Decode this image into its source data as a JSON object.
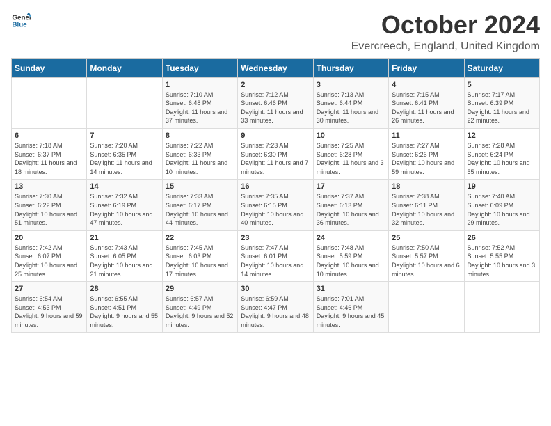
{
  "logo": {
    "line1": "General",
    "line2": "Blue"
  },
  "title": "October 2024",
  "location": "Evercreech, England, United Kingdom",
  "days_header": [
    "Sunday",
    "Monday",
    "Tuesday",
    "Wednesday",
    "Thursday",
    "Friday",
    "Saturday"
  ],
  "weeks": [
    [
      {
        "day": "",
        "sunrise": "",
        "sunset": "",
        "daylight": ""
      },
      {
        "day": "",
        "sunrise": "",
        "sunset": "",
        "daylight": ""
      },
      {
        "day": "1",
        "sunrise": "Sunrise: 7:10 AM",
        "sunset": "Sunset: 6:48 PM",
        "daylight": "Daylight: 11 hours and 37 minutes."
      },
      {
        "day": "2",
        "sunrise": "Sunrise: 7:12 AM",
        "sunset": "Sunset: 6:46 PM",
        "daylight": "Daylight: 11 hours and 33 minutes."
      },
      {
        "day": "3",
        "sunrise": "Sunrise: 7:13 AM",
        "sunset": "Sunset: 6:44 PM",
        "daylight": "Daylight: 11 hours and 30 minutes."
      },
      {
        "day": "4",
        "sunrise": "Sunrise: 7:15 AM",
        "sunset": "Sunset: 6:41 PM",
        "daylight": "Daylight: 11 hours and 26 minutes."
      },
      {
        "day": "5",
        "sunrise": "Sunrise: 7:17 AM",
        "sunset": "Sunset: 6:39 PM",
        "daylight": "Daylight: 11 hours and 22 minutes."
      }
    ],
    [
      {
        "day": "6",
        "sunrise": "Sunrise: 7:18 AM",
        "sunset": "Sunset: 6:37 PM",
        "daylight": "Daylight: 11 hours and 18 minutes."
      },
      {
        "day": "7",
        "sunrise": "Sunrise: 7:20 AM",
        "sunset": "Sunset: 6:35 PM",
        "daylight": "Daylight: 11 hours and 14 minutes."
      },
      {
        "day": "8",
        "sunrise": "Sunrise: 7:22 AM",
        "sunset": "Sunset: 6:33 PM",
        "daylight": "Daylight: 11 hours and 10 minutes."
      },
      {
        "day": "9",
        "sunrise": "Sunrise: 7:23 AM",
        "sunset": "Sunset: 6:30 PM",
        "daylight": "Daylight: 11 hours and 7 minutes."
      },
      {
        "day": "10",
        "sunrise": "Sunrise: 7:25 AM",
        "sunset": "Sunset: 6:28 PM",
        "daylight": "Daylight: 11 hours and 3 minutes."
      },
      {
        "day": "11",
        "sunrise": "Sunrise: 7:27 AM",
        "sunset": "Sunset: 6:26 PM",
        "daylight": "Daylight: 10 hours and 59 minutes."
      },
      {
        "day": "12",
        "sunrise": "Sunrise: 7:28 AM",
        "sunset": "Sunset: 6:24 PM",
        "daylight": "Daylight: 10 hours and 55 minutes."
      }
    ],
    [
      {
        "day": "13",
        "sunrise": "Sunrise: 7:30 AM",
        "sunset": "Sunset: 6:22 PM",
        "daylight": "Daylight: 10 hours and 51 minutes."
      },
      {
        "day": "14",
        "sunrise": "Sunrise: 7:32 AM",
        "sunset": "Sunset: 6:19 PM",
        "daylight": "Daylight: 10 hours and 47 minutes."
      },
      {
        "day": "15",
        "sunrise": "Sunrise: 7:33 AM",
        "sunset": "Sunset: 6:17 PM",
        "daylight": "Daylight: 10 hours and 44 minutes."
      },
      {
        "day": "16",
        "sunrise": "Sunrise: 7:35 AM",
        "sunset": "Sunset: 6:15 PM",
        "daylight": "Daylight: 10 hours and 40 minutes."
      },
      {
        "day": "17",
        "sunrise": "Sunrise: 7:37 AM",
        "sunset": "Sunset: 6:13 PM",
        "daylight": "Daylight: 10 hours and 36 minutes."
      },
      {
        "day": "18",
        "sunrise": "Sunrise: 7:38 AM",
        "sunset": "Sunset: 6:11 PM",
        "daylight": "Daylight: 10 hours and 32 minutes."
      },
      {
        "day": "19",
        "sunrise": "Sunrise: 7:40 AM",
        "sunset": "Sunset: 6:09 PM",
        "daylight": "Daylight: 10 hours and 29 minutes."
      }
    ],
    [
      {
        "day": "20",
        "sunrise": "Sunrise: 7:42 AM",
        "sunset": "Sunset: 6:07 PM",
        "daylight": "Daylight: 10 hours and 25 minutes."
      },
      {
        "day": "21",
        "sunrise": "Sunrise: 7:43 AM",
        "sunset": "Sunset: 6:05 PM",
        "daylight": "Daylight: 10 hours and 21 minutes."
      },
      {
        "day": "22",
        "sunrise": "Sunrise: 7:45 AM",
        "sunset": "Sunset: 6:03 PM",
        "daylight": "Daylight: 10 hours and 17 minutes."
      },
      {
        "day": "23",
        "sunrise": "Sunrise: 7:47 AM",
        "sunset": "Sunset: 6:01 PM",
        "daylight": "Daylight: 10 hours and 14 minutes."
      },
      {
        "day": "24",
        "sunrise": "Sunrise: 7:48 AM",
        "sunset": "Sunset: 5:59 PM",
        "daylight": "Daylight: 10 hours and 10 minutes."
      },
      {
        "day": "25",
        "sunrise": "Sunrise: 7:50 AM",
        "sunset": "Sunset: 5:57 PM",
        "daylight": "Daylight: 10 hours and 6 minutes."
      },
      {
        "day": "26",
        "sunrise": "Sunrise: 7:52 AM",
        "sunset": "Sunset: 5:55 PM",
        "daylight": "Daylight: 10 hours and 3 minutes."
      }
    ],
    [
      {
        "day": "27",
        "sunrise": "Sunrise: 6:54 AM",
        "sunset": "Sunset: 4:53 PM",
        "daylight": "Daylight: 9 hours and 59 minutes."
      },
      {
        "day": "28",
        "sunrise": "Sunrise: 6:55 AM",
        "sunset": "Sunset: 4:51 PM",
        "daylight": "Daylight: 9 hours and 55 minutes."
      },
      {
        "day": "29",
        "sunrise": "Sunrise: 6:57 AM",
        "sunset": "Sunset: 4:49 PM",
        "daylight": "Daylight: 9 hours and 52 minutes."
      },
      {
        "day": "30",
        "sunrise": "Sunrise: 6:59 AM",
        "sunset": "Sunset: 4:47 PM",
        "daylight": "Daylight: 9 hours and 48 minutes."
      },
      {
        "day": "31",
        "sunrise": "Sunrise: 7:01 AM",
        "sunset": "Sunset: 4:46 PM",
        "daylight": "Daylight: 9 hours and 45 minutes."
      },
      {
        "day": "",
        "sunrise": "",
        "sunset": "",
        "daylight": ""
      },
      {
        "day": "",
        "sunrise": "",
        "sunset": "",
        "daylight": ""
      }
    ]
  ]
}
